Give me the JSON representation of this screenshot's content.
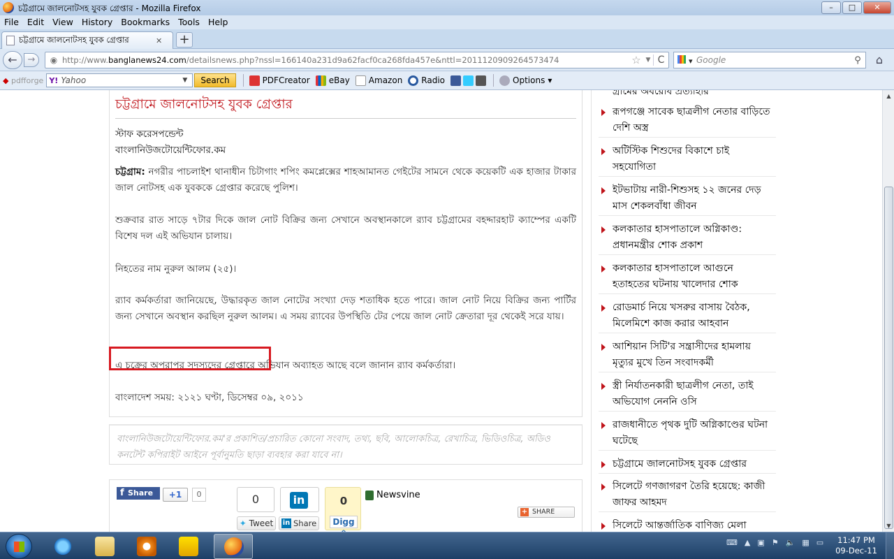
{
  "window": {
    "title": "চট্টগ্রামে জালনোটসহ যুবক গ্রেপ্তার - Mozilla Firefox",
    "minimize": "–",
    "maximize": "□",
    "close": "✕"
  },
  "menu": [
    "File",
    "Edit",
    "View",
    "History",
    "Bookmarks",
    "Tools",
    "Help"
  ],
  "tab": {
    "label": "চট্টগ্রামে জালনোটসহ যুবক গ্রেপ্তার",
    "close": "✕",
    "new": "+"
  },
  "nav": {
    "back": "←",
    "forward": "→",
    "url_prefix": "http://www.",
    "url_domain": "banglanews24.com",
    "url_rest": "/detailsnews.php?nssl=166140a231d9a62facf0ca268fda457e&nttl=20111209092645734­74",
    "star": "☆",
    "reload": "C",
    "search_placeholder": "Google",
    "home": "⌂"
  },
  "toolbar": {
    "pdfforge": "pdfforge",
    "yahoo_placeholder": "Yahoo",
    "search_btn": "Search",
    "items": [
      "PDFCreator",
      "eBay",
      "Amazon",
      "Radio"
    ],
    "options": "Options"
  },
  "article": {
    "title": "চট্টগ্রামে জালনোটসহ যুবক গ্রেপ্তার",
    "byline1": "স্টাফ করেসপন্ডেন্ট",
    "byline2": "বাংলানিউজটোয়েন্টিফোর.কম",
    "p1_lead": "চট্টগ্রাম:",
    "p1": " নগরীর পাচলাইশ থানাধীন চিটাগাং শপিং কমপ্লেক্সের শাহআমানত গেইটের সামনে থেকে কয়েকটি এক হাজার টাকার জাল নোটসহ এক যুবককে গ্রেপ্তার করেছে পুলিশ।",
    "p2": "শুক্রবার রাত সাড়ে ৭টার দিকে জাল নোট বিক্রির জন্য সেখানে অবস্থানকালে র‌্যাব চট্টগ্রামের  বহদ্দারহাট ক্যাম্পের একটি বিশেষ দল এই অভিযান চালায়।",
    "p3": "নিহতের নাম নুরুল আলম (২৫)।",
    "p4": "র‌্যাব কর্মকর্তারা জানিয়েছে, উদ্ধারকৃত জাল নোটের সংখ্যা দেড় শতাধিক হতে পারে।  জাল নোট নিয়ে বিক্রির জন্য পার্টির জন্য সেখানে অবস্থান করছিল নুরুল আলম। এ সময় র‌্যাবের উপস্থিতি টের পেয়ে জাল নোট ক্রেতারা দূর থেকেই সরে যায়।",
    "p5": "এ চক্রের অপরাপর সদস্যদের গ্রেপ্তারে অভিযান অব্যাহত আছে বলে জানান র‌্যাব কর্মকর্তারা।",
    "p6": "বাংলাদেশ সময়: ২১২১ ঘণ্টা, ডিসেম্বর ০৯, ২০১১",
    "disclaimer": "বাংলানিউজটোয়েন্টিফোর.কম'র প্রকাশিত/প্রচারিত কোনো সংবাদ, তথ্য, ছবি, আলোকচিত্র, রেখাচিত্র, ভিডিওচিত্র, অডিও কনটেন্ট কপিরাইট আইনে পূর্বানুমতি ছাড়া ব্যবহার করা যাবে না।"
  },
  "share": {
    "fb": "Share",
    "gplus": "+1",
    "gplus_count": "0",
    "tweet_count": "0",
    "tweet": "Tweet",
    "li_logo": "in",
    "li": "Share",
    "digg_count": "0",
    "digg": "Digg",
    "newsvine": "Newsvine",
    "share": "SHARE"
  },
  "sidebar": {
    "top_partial": "গ্রামের অবরোধ প্রত্যাহার",
    "items": [
      "রূপগঞ্জে সাবেক ছাত্রলীগ নেতার বাড়িতে দেশি অস্ত্র",
      "অটিস্টিক শিশুদের বিকাশে চাই সহযোগিতা",
      "ইটভাটায় নারী-শিশুসহ ১২ জনের দেড় মাস শেকলবাঁধা জীবন",
      "কলকাতার হাসপাতালে অগ্নিকাণ্ড: প্রধানমন্ত্রীর শোক প্রকাশ",
      "কলকাতার হাসপাতালে আগুনে হতাহতের ঘটনায় খালেদার শোক",
      "রোডমার্চ নিয়ে খসরুর বাসায় বৈঠক, মিলেমিশে কাজ করার আহবান",
      "আশিয়ান সিটি'র সন্ত্রাসীদের হামলায় মৃত্যুর মুখে তিন সংবাদকর্মী",
      "স্ত্রী নির্যাতনকারী ছাত্রলীগ নেতা, তাই অভিযোগ নেননি ওসি",
      "রাজধানীতে পৃথক দুটি অগ্নিকাণ্ডের ঘটনা ঘটেছে",
      "চট্টগ্রামে জালনোটসহ যুবক গ্রেপ্তার",
      "সিলেটে গণজাগরণ তৈরি হয়েছে: কাজী জাফর আহমদ",
      "সিলেটে আন্তর্জাতিক বাণিজ্য মেলা"
    ]
  },
  "taskbar": {
    "time": "11:47 PM",
    "date": "09-Dec-11"
  }
}
